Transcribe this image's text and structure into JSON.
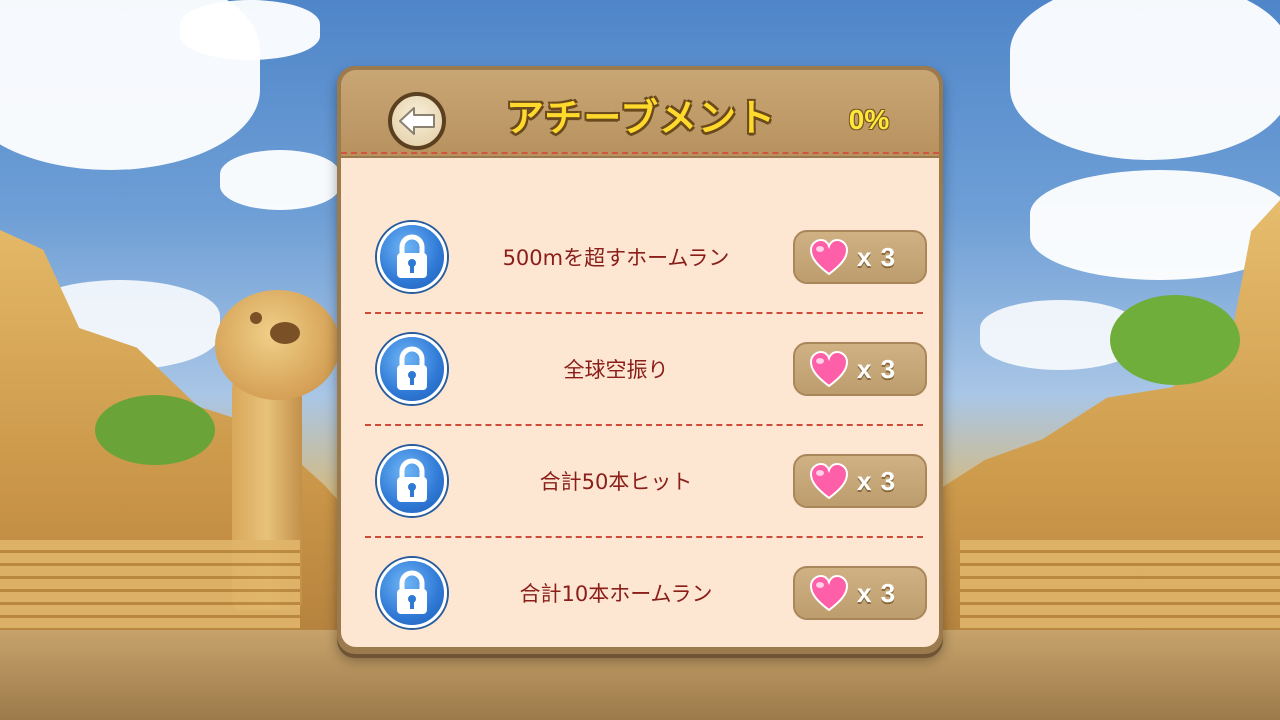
{
  "header": {
    "title": "アチーブメント",
    "progress": "0%"
  },
  "achievements": [
    {
      "label": "500mを超すホームラン",
      "reward": "x 3",
      "locked": true
    },
    {
      "label": "全球空振り",
      "reward": "x 3",
      "locked": true
    },
    {
      "label": "合計50本ヒット",
      "reward": "x 3",
      "locked": true
    },
    {
      "label": "合計10本ホームラン",
      "reward": "x 3",
      "locked": true
    }
  ],
  "icons": {
    "back": "back-arrow-icon",
    "lock": "lock-icon",
    "reward": "heart-icon"
  },
  "colors": {
    "title": "#ffd92b",
    "label": "#8a1f1a",
    "panel_body": "#fde6d2",
    "divider": "#cc4b3a",
    "heart": "#ff5fa8"
  }
}
